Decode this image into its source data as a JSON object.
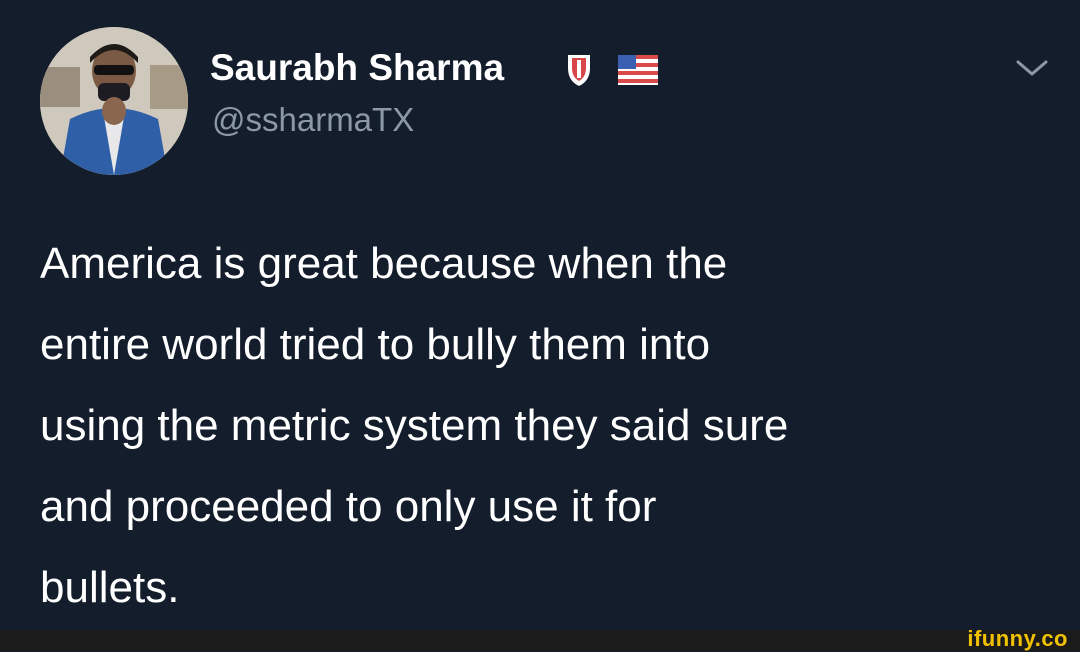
{
  "tweet": {
    "display_name": "Saurabh Sharma",
    "handle": "@ssharmaTX",
    "badges": [
      "shield-icon",
      "us-flag-icon"
    ],
    "lines": [
      "America is great because when the",
      "entire world tried to bully them into",
      "using the metric system they said sure",
      "and proceeded to only use it for",
      "bullets."
    ]
  },
  "watermark": {
    "text": "ifunny.co"
  },
  "colors": {
    "background": "#141d2c",
    "text": "#ffffff",
    "handle": "#8b98a5",
    "watermark": "#f2c200"
  }
}
